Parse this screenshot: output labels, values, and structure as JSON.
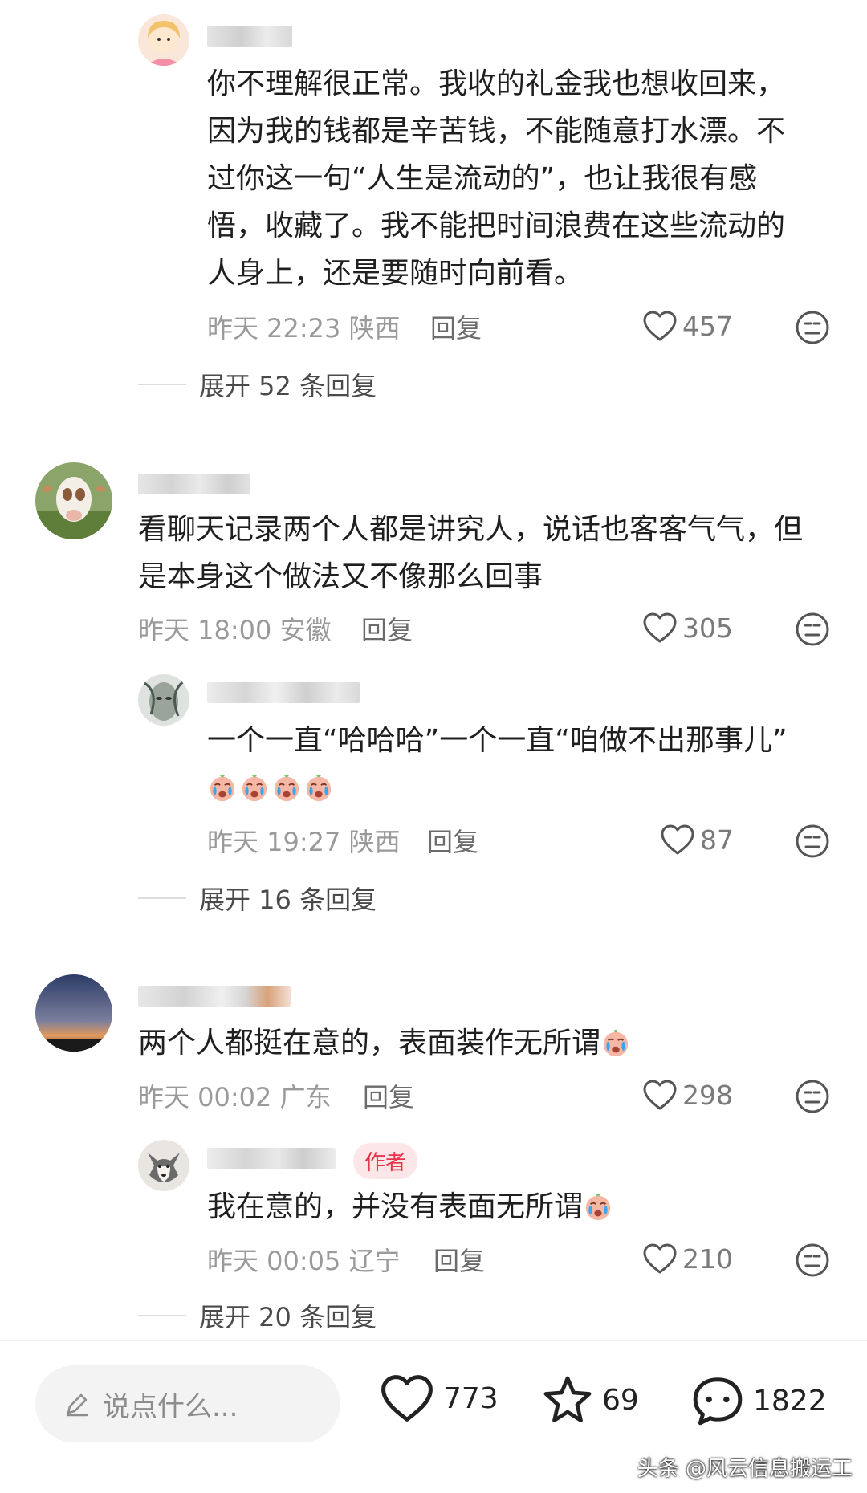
{
  "comments": [
    {
      "text_lines": [
        "你不理解很正常。我收的礼金我也想收回来，",
        "因为我的钱都是辛苦钱，不能随意打水漂。不",
        "过你这一句“人生是流动的”，也让我很有感",
        "悟，收藏了。我不能把时间浪费在这些流动的",
        "人身上，还是要随时向前看。"
      ],
      "time": "昨天 22:23 陕西",
      "reply": "回复",
      "likes": "457",
      "expand": "展开 52 条回复"
    },
    {
      "text_lines": [
        "看聊天记录两个人都是讲究人，说话也客客气气，但",
        "是本身这个做法又不像那么回事"
      ],
      "time": "昨天 18:00 安徽",
      "reply": "回复",
      "likes": "305"
    },
    {
      "text_lines": [
        "一个一直“哈哈哈”一个一直“咱做不出那事儿”"
      ],
      "time": "昨天 19:27 陕西",
      "reply": "回复",
      "likes": "87",
      "expand": "展开 16 条回复"
    },
    {
      "text": "两个人都挺在意的，表面装作无所谓",
      "time": "昨天 00:02 广东",
      "reply": "回复",
      "likes": "298"
    },
    {
      "badge": "作者",
      "text": "我在意的，并没有表面无所谓",
      "time": "昨天 00:05 辽宁",
      "reply": "回复",
      "likes": "210",
      "expand": "展开 20 条回复"
    }
  ],
  "bottom_bar": {
    "input_placeholder": "说点什么...",
    "likes": "773",
    "favorites": "69",
    "comments": "1822"
  },
  "watermark": "头条 @风云信息搬运工",
  "icons": [
    "heart-outline-icon",
    "neutral-face-icon",
    "crying-emoji-icon",
    "pencil-icon",
    "star-icon",
    "chat-bubble-icon"
  ],
  "colors": {
    "author_badge_bg": "#fde6e8",
    "author_badge_text": "#e8334a"
  }
}
